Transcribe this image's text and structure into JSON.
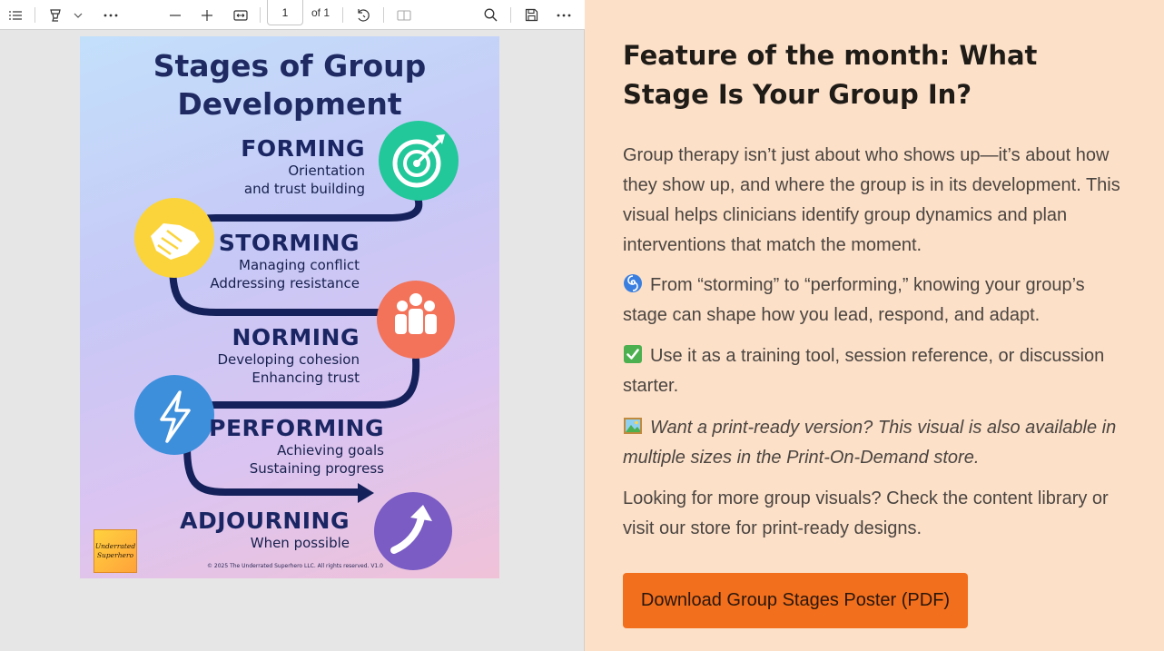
{
  "viewer": {
    "toolbar": {
      "page_current": "1",
      "page_total": "of 1",
      "icons": [
        "contents-icon",
        "highlighter-icon",
        "chevron-down-icon",
        "more-horizontal-icon",
        "zoom-out-icon",
        "zoom-in-icon",
        "fit-width-icon",
        "rotate-icon",
        "page-view-icon",
        "search-icon",
        "save-icon",
        "more-horizontal-icon"
      ]
    },
    "poster": {
      "title_line1": "Stages of Group",
      "title_line2": "Development",
      "stages": [
        {
          "name": "FORMING",
          "lines": [
            "Orientation",
            "and trust building"
          ],
          "color": "#22c79a",
          "icon": "target-icon"
        },
        {
          "name": "STORMING",
          "lines": [
            "Managing conflict",
            "Addressing resistance"
          ],
          "color": "#fbd43b",
          "icon": "handshake-icon"
        },
        {
          "name": "NORMING",
          "lines": [
            "Developing cohesion",
            "Enhancing trust"
          ],
          "color": "#f2735a",
          "icon": "group-icon"
        },
        {
          "name": "PERFORMING",
          "lines": [
            "Achieving goals",
            "Sustaining progress"
          ],
          "color": "#3d8fdc",
          "icon": "lightning-icon"
        },
        {
          "name": "ADJOURNING",
          "lines": [
            "When possible"
          ],
          "color": "#7a5cc4",
          "icon": "arrow-up-right-icon"
        }
      ],
      "logo_line1": "Underrated",
      "logo_line2": "Superhero",
      "copyright": "© 2025 The Underrated Superhero LLC. All rights reserved. V1.0"
    }
  },
  "article": {
    "title": "Feature of the month: What Stage Is Your Group In?",
    "paragraph1": "Group therapy isn’t just about who shows up—it’s about how they show up, and where the group is in its development. This visual helps clinicians identify group dynamics and plan interventions that match the moment.",
    "paragraph2": "From “storming” to “performing,” knowing your group’s stage can shape how you lead, respond, and adapt.",
    "paragraph3": "Use it as a training tool, session reference, or discussion starter.",
    "paragraph4": "Want a print-ready version? This visual is also available in multiple sizes in the Print-On-Demand store.",
    "paragraph5": "Looking for more group visuals? Check the content library or visit our store for print-ready designs.",
    "download_button": "Download Group Stages Poster (PDF)",
    "colors": {
      "background": "#fde0c8",
      "button": "#f26f1d",
      "title": "#1f1b17"
    }
  }
}
